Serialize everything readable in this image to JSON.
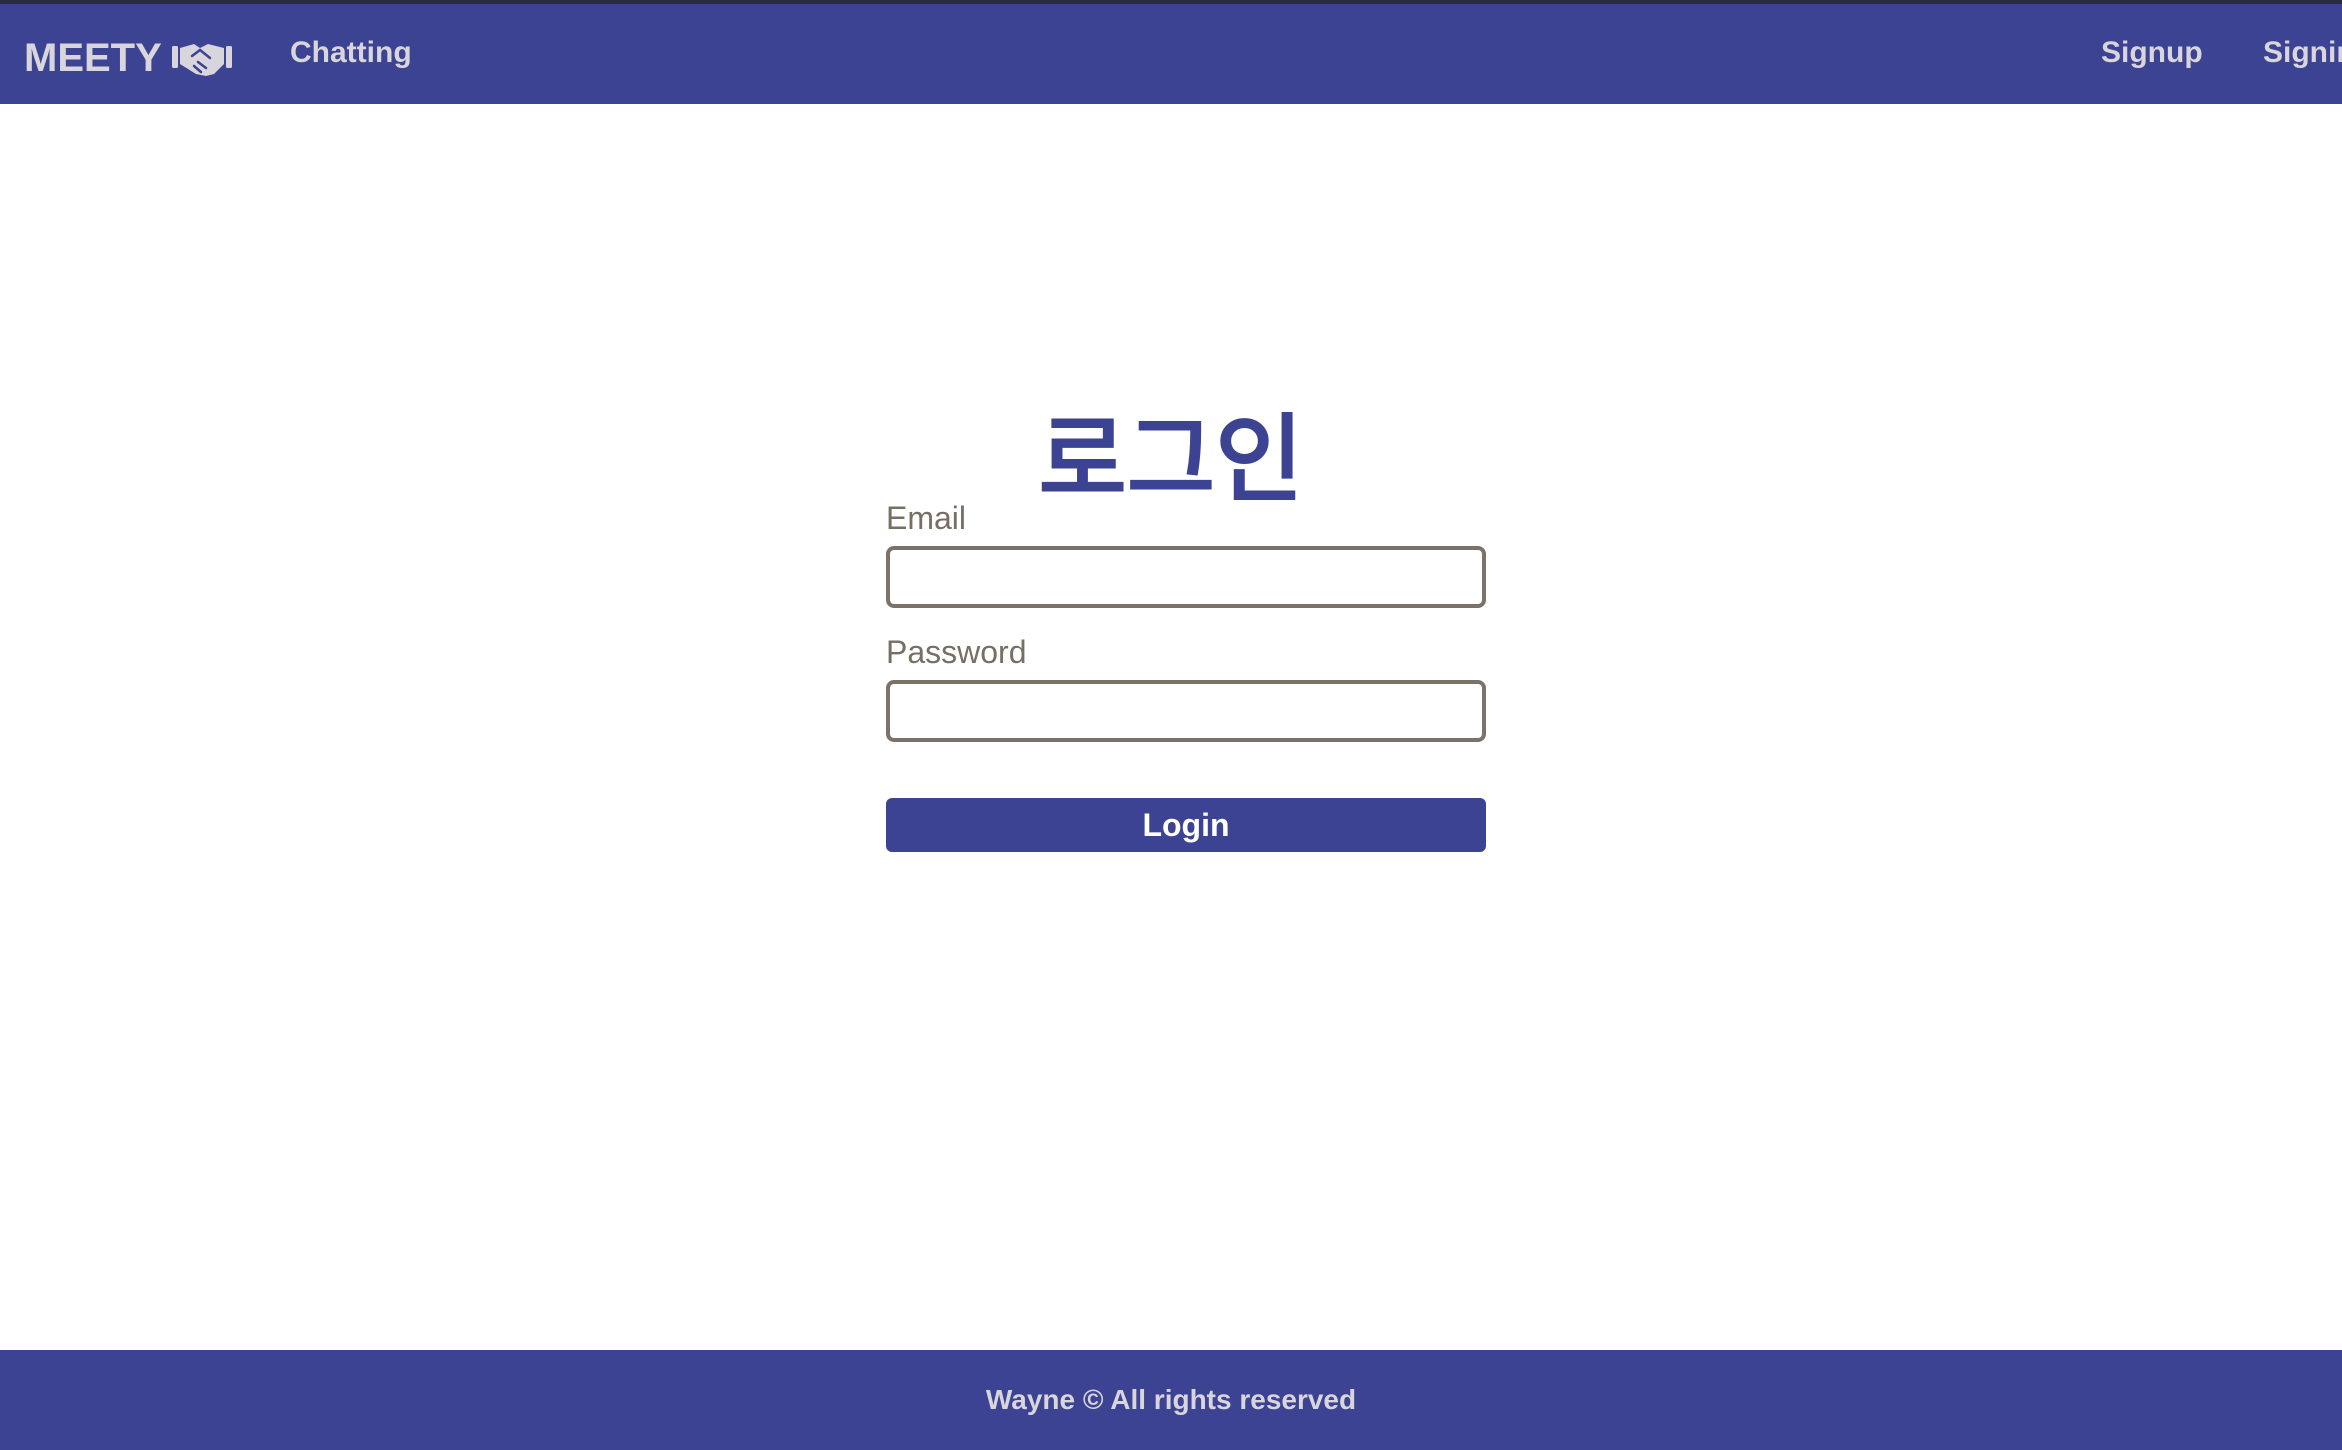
{
  "colors": {
    "brand": "#3b4392",
    "nav_text": "#d9d5dc",
    "label_text": "#776e64",
    "input_border": "#7b736a",
    "background": "#ffffff"
  },
  "navbar": {
    "brand": "MEETY",
    "brand_icon": "handshake-icon",
    "links": {
      "chatting": "Chatting",
      "signup": "Signup",
      "signin": "Signin"
    }
  },
  "login": {
    "title": "로그인",
    "email_label": "Email",
    "email_value": "",
    "password_label": "Password",
    "password_value": "",
    "submit_label": "Login"
  },
  "footer": {
    "text": "Wayne © All rights reserved"
  }
}
